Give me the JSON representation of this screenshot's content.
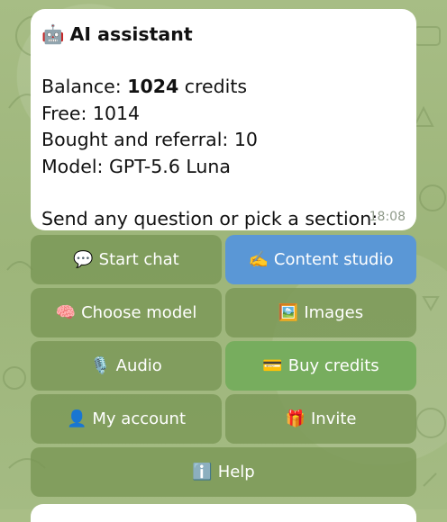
{
  "message": {
    "title_icon": "🤖",
    "title": "AI assistant",
    "balance_label": "Balance: ",
    "balance_value": "1024",
    "balance_unit": " credits",
    "free_line": "Free: 1014",
    "bought_line": "Bought and referral: 10",
    "model_line": "Model: GPT-5.6 Luna",
    "prompt_line": "Send any question or pick a section:",
    "time": "18:08"
  },
  "keyboard": {
    "start_chat": {
      "icon": "💬",
      "label": "Start chat"
    },
    "content_studio": {
      "icon": "✍️",
      "label": "Content studio"
    },
    "choose_model": {
      "icon": "🧠",
      "label": "Choose model"
    },
    "images": {
      "icon": "🖼️",
      "label": "Images"
    },
    "audio": {
      "icon": "🎙️",
      "label": "Audio"
    },
    "buy_credits": {
      "icon": "💳",
      "label": "Buy credits"
    },
    "my_account": {
      "icon": "👤",
      "label": "My account"
    },
    "invite": {
      "icon": "🎁",
      "label": "Invite"
    },
    "help": {
      "icon": "ℹ️",
      "label": "Help"
    }
  },
  "colors": {
    "background": "#a9be86",
    "button": "#78965a",
    "highlight_blue": "#5a97d6",
    "highlight_green": "#77ad5e"
  }
}
